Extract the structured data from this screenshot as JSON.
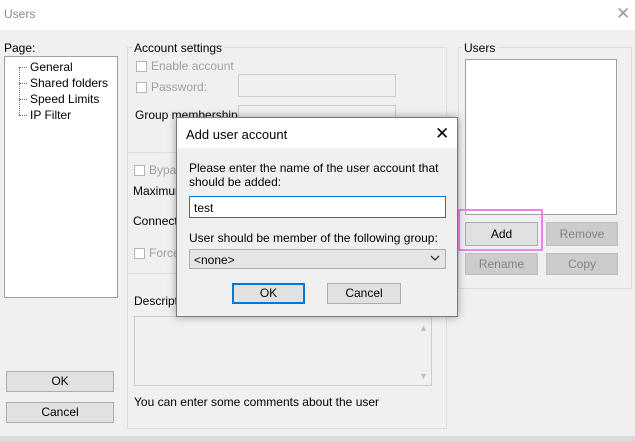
{
  "window": {
    "title": "Users",
    "close_icon": "✕"
  },
  "page_panel": {
    "label": "Page:",
    "items": [
      "General",
      "Shared folders",
      "Speed Limits",
      "IP Filter"
    ],
    "ok_label": "OK",
    "cancel_label": "Cancel"
  },
  "account_settings": {
    "group_label": "Account settings",
    "enable_account": "Enable account",
    "password_label": "Password:",
    "group_membership_label": "Group membership:",
    "bypass_label_partial": "Bypas",
    "maximum_label_partial": "Maximum",
    "connections_label_partial": "Connectio",
    "force_label_partial": "Force",
    "description_label_partial": "Descripti",
    "comment_hint": "You can enter some comments about the user"
  },
  "users_panel": {
    "group_label": "Users",
    "add_label": "Add",
    "remove_label": "Remove",
    "rename_label": "Rename",
    "copy_label": "Copy"
  },
  "dialog": {
    "title": "Add user account",
    "prompt": "Please enter the name of the user account that should be added:",
    "username_value": "test",
    "group_prompt": "User should be member of the following group:",
    "group_selected": "<none>",
    "ok_label": "OK",
    "cancel_label": "Cancel",
    "close_icon": "✕"
  },
  "colors": {
    "accent": "#0078d7",
    "highlight": "#ee82ee",
    "dialog_bg": "#f0f0f0"
  }
}
